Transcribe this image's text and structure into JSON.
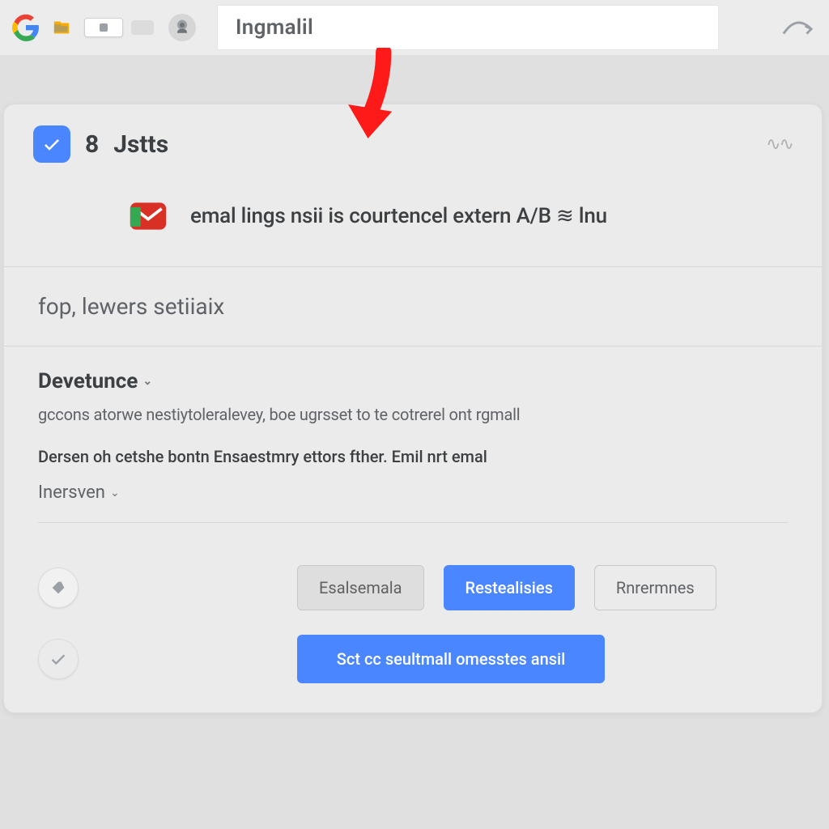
{
  "toolbar": {
    "address_text": "Ingmalil"
  },
  "arrow": {
    "color": "#ff1a1a"
  },
  "header": {
    "count": "8",
    "title": "Jstts",
    "right_glyph": "∿∿"
  },
  "subrow": {
    "text": "emal lings nsii is courtencel extern A/B ≋ lnu"
  },
  "row1": {
    "text": "fop,  lewers setiiaix"
  },
  "block": {
    "title": "Devetunce",
    "caret": "⌄",
    "desc": "gccons atorwe nestiytoleralevey, boe ugrsset to te cotrerel ont rgmall",
    "sub": "Dersen oh cetshe bontn Ensaestmry ettors fther. Emil nrt emal",
    "dropdown": "Inersven",
    "dropdown_caret": "⌄"
  },
  "buttons": {
    "grey": "Esalsemala",
    "blue": "Restealisies",
    "outline": "Rnrermnes",
    "primary_wide": "Sct cc seultmall omesstes ansil"
  }
}
